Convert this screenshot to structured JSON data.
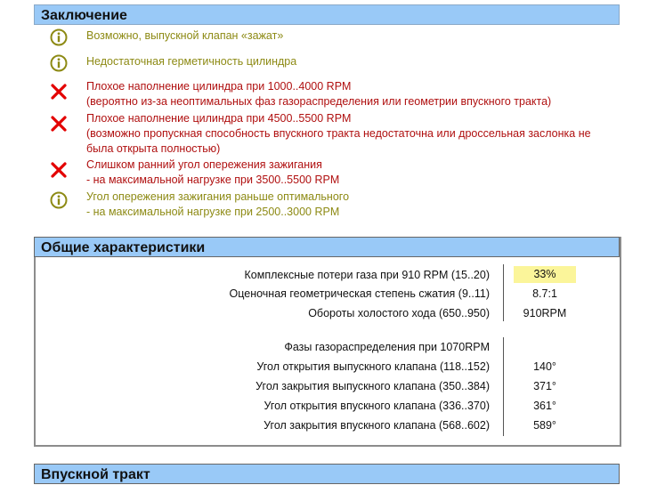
{
  "conclusion": {
    "title": "Заключение",
    "items": [
      {
        "type": "info",
        "text": "Возможно, выпускной клапан «зажат»"
      },
      {
        "type": "info",
        "text": "Недостаточная герметичность цилиндра"
      },
      {
        "type": "error",
        "text": "Плохое наполнение цилиндра при 1000..4000 RPM\n(вероятно из-за неоптимальных фаз газораспределения или геометрии впускного тракта)"
      },
      {
        "type": "error",
        "text": "Плохое наполнение цилиндра при 4500..5500 RPM\n(возможно пропускная способность впускного тракта недостаточна или дроссельная заслонка не\nбыла открыта полностью)"
      },
      {
        "type": "error",
        "text": "Слишком ранний угол опережения зажигания\n- на максимальной нагрузке при 3500..5500 RPM"
      },
      {
        "type": "info",
        "text": "Угол опережения зажигания раньше оптимального\n- на максимальной нагрузке при 2500..3000 RPM"
      }
    ]
  },
  "specs": {
    "title": "Общие характеристики",
    "rows": [
      {
        "label": "Комплексные потери газа при 910 RPM (15..20)",
        "value": "33%",
        "highlight": true
      },
      {
        "label": "Оценочная геометрическая степень сжатия (9..11)",
        "value": "8.7:1"
      },
      {
        "label": "Обороты холостого хода (650..950)",
        "value": "910RPM"
      },
      {
        "label": "Фазы газораспределения при 1070RPM",
        "value": ""
      },
      {
        "label": "Угол открытия выпускного клапана (118..152)",
        "value": "140°"
      },
      {
        "label": "Угол закрытия выпускного клапана (350..384)",
        "value": "371°"
      },
      {
        "label": "Угол открытия впускного клапана (336..370)",
        "value": "361°"
      },
      {
        "label": "Угол закрытия впускного клапана (568..602)",
        "value": "589°"
      }
    ]
  },
  "intake": {
    "title": "Впускной тракт"
  },
  "colors": {
    "header_bg": "#99c9f7",
    "ok_text": "#8d8a14",
    "error_text": "#b01010",
    "highlight": "#fbf59a"
  }
}
